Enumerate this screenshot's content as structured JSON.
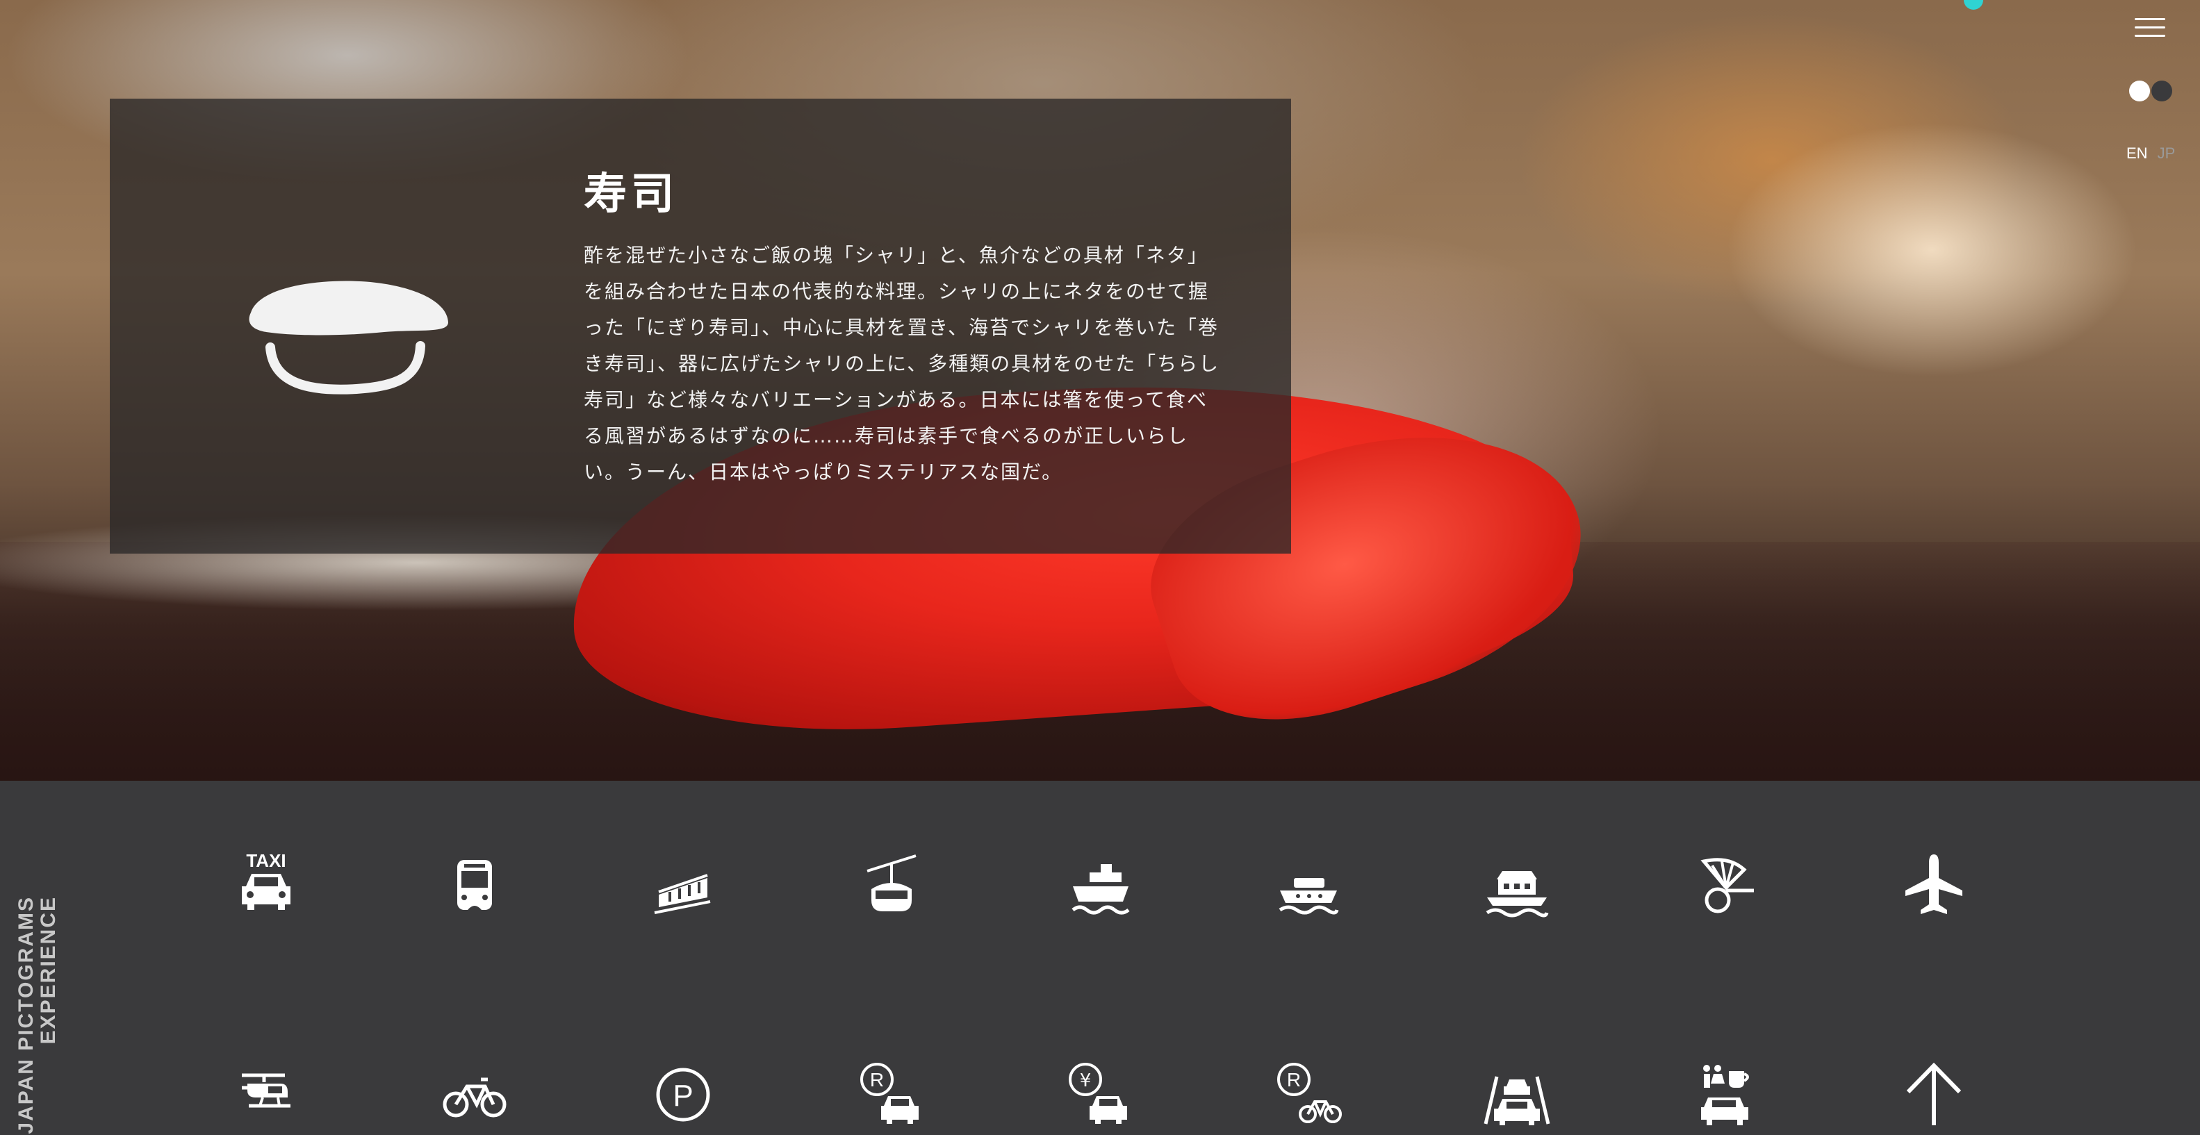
{
  "article": {
    "title": "寿司",
    "description": "酢を混ぜた小さなご飯の塊「シャリ」と、魚介などの具材「ネタ」を組み合わせた日本の代表的な料理。シャリの上にネタをのせて握った「にぎり寿司」、中心に具材を置き、海苔でシャリを巻いた「巻き寿司」、器に広げたシャリの上に、多種類の具材をのせた「ちらし寿司」など様々なバリエーションがある。日本には箸を使って食べる風習があるはずなのに……寿司は素手で食べるのが正しいらしい。うーん、日本はやっぱりミステリアスな国だ。",
    "pictogram_icon": "sushi-icon"
  },
  "controls": {
    "menu_icon": "hamburger-menu-icon",
    "lang_en": "EN",
    "lang_jp": "JP",
    "active_lang": "EN"
  },
  "side_title": {
    "line1": "EXPERIENCE",
    "line2": "JAPAN PICTOGRAMS"
  },
  "pictograms": {
    "row1": [
      {
        "icon": "taxi-icon",
        "label": "TAXI"
      },
      {
        "icon": "bus-icon"
      },
      {
        "icon": "cable-car-icon"
      },
      {
        "icon": "ropeway-icon"
      },
      {
        "icon": "ferry-icon"
      },
      {
        "icon": "boat-icon"
      },
      {
        "icon": "houseboat-icon"
      },
      {
        "icon": "rickshaw-icon"
      },
      {
        "icon": "airplane-icon"
      }
    ],
    "row2": [
      {
        "icon": "helicopter-icon"
      },
      {
        "icon": "bicycle-icon"
      },
      {
        "icon": "parking-icon",
        "label": "P"
      },
      {
        "icon": "car-rental-icon",
        "label": "R"
      },
      {
        "icon": "toll-road-icon",
        "label": "¥"
      },
      {
        "icon": "bicycle-rental-icon",
        "label": "R"
      },
      {
        "icon": "road-car-icon"
      },
      {
        "icon": "service-area-icon"
      },
      {
        "icon": "up-arrow-icon"
      }
    ]
  },
  "colors": {
    "accent_dot": "#2fd3d3",
    "grid_bg": "#3a3a3c"
  }
}
